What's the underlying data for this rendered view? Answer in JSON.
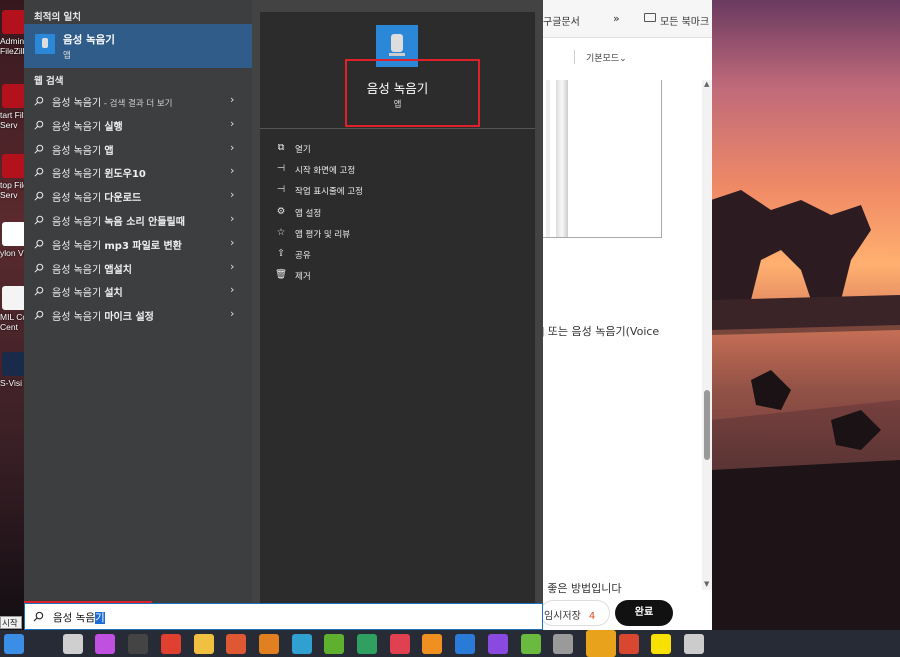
{
  "desktop": {
    "icons": [
      {
        "label": "Admini\nFileZilla",
        "icon": "filezilla-icon"
      },
      {
        "label": "tart File\nServ",
        "icon": "filezilla-icon"
      },
      {
        "label": "top File\nServ",
        "icon": "filezilla-icon"
      },
      {
        "label": "ylon Vi",
        "icon": "app-icon"
      },
      {
        "label": "MIL Co\nCent",
        "icon": "meter-icon"
      },
      {
        "label": "S-Visi",
        "icon": "camera-icon"
      }
    ]
  },
  "browser": {
    "bookmark_google": "구글문서",
    "bookmark_more": "»",
    "bookmark_all": "모든 북마크",
    "mode_select": "기본모드",
    "body_text": "] 또는 음성 녹음기(Voice",
    "body_text2": ": 좋은 방법입니다",
    "temp_save_label": "임시저장",
    "temp_save_count": "4",
    "done_label": "완료"
  },
  "start_menu": {
    "best_match_title": "최적의 일치",
    "best_match": {
      "name": "음성 녹음기",
      "kind": "앱"
    },
    "web_search_title": "웹 검색",
    "web_results": [
      {
        "prefix": "음성 녹음기",
        "suffix": " - 검색 결과 더 보기",
        "bold": false
      },
      {
        "prefix": "음성 녹음기 ",
        "suffix": "실행",
        "bold": true
      },
      {
        "prefix": "음성 녹음기 ",
        "suffix": "앱",
        "bold": true
      },
      {
        "prefix": "음성 녹음기 ",
        "suffix": "윈도우10",
        "bold": true
      },
      {
        "prefix": "음성 녹음기 ",
        "suffix": "다운로드",
        "bold": true
      },
      {
        "prefix": "음성 녹음기 ",
        "suffix": "녹음 소리 안들릴때",
        "bold": true
      },
      {
        "prefix": "음성 녹음기 ",
        "suffix": "mp3 파일로 변환",
        "bold": true
      },
      {
        "prefix": "음성 녹음기 ",
        "suffix": "앱설치",
        "bold": true
      },
      {
        "prefix": "음성 녹음기 ",
        "suffix": "설치",
        "bold": true
      },
      {
        "prefix": "음성 녹음기 ",
        "suffix": "마이크 설정",
        "bold": true
      }
    ],
    "detail": {
      "name": "음성 녹음기",
      "kind": "앱",
      "actions": [
        {
          "icon": "open-icon",
          "label": "열기"
        },
        {
          "icon": "pin-icon",
          "label": "시작 화면에 고정"
        },
        {
          "icon": "pin-icon",
          "label": "작업 표시줄에 고정"
        },
        {
          "icon": "gear-icon",
          "label": "앱 설정"
        },
        {
          "icon": "star-icon",
          "label": "앱 평가 및 리뷰"
        },
        {
          "icon": "share-icon",
          "label": "공유"
        },
        {
          "icon": "trash-icon",
          "label": "제거"
        }
      ]
    }
  },
  "search": {
    "typed": "음성 녹음",
    "selected": "기"
  },
  "start_tooltip": "시작",
  "taskbar": {
    "apps": [
      "windows-start-icon",
      "task-view-icon",
      "copilot-icon",
      "terminal-icon",
      "chrome-icon",
      "file-explorer-icon",
      "duckduckgo-icon",
      "winamp-icon",
      "photos-icon",
      "notepad-icon",
      "edge-icon",
      "media-player-icon",
      "search-app-icon",
      "vscode-icon",
      "visual-studio-icon",
      "spring-icon",
      "database-icon",
      "sticky-notes-icon",
      "chrome-profile-icon",
      "kakaotalk-icon",
      "voice-recorder-icon"
    ]
  }
}
